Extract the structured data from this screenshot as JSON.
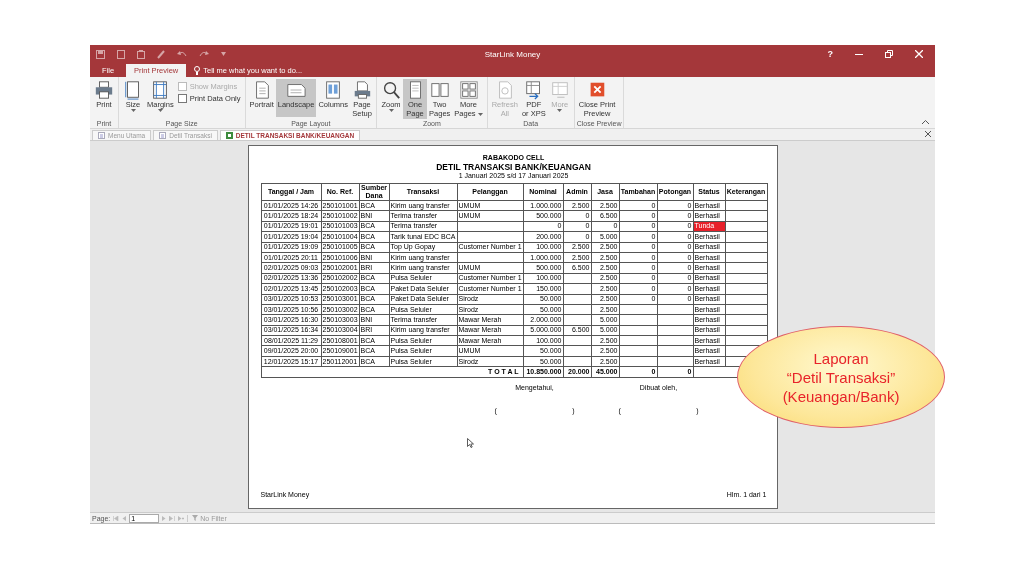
{
  "window": {
    "title": "StarLink Money",
    "help": "?"
  },
  "ribbon": {
    "tabs": [
      {
        "label": "File",
        "selected": false
      },
      {
        "label": "Print Preview",
        "selected": true
      }
    ],
    "tell_me": "Tell me what you want to do...",
    "groups": [
      {
        "label": "Print",
        "items": [
          {
            "kind": "large",
            "lines": [
              "Print"
            ],
            "selected": false,
            "disabled": false,
            "dropdown": false
          }
        ]
      },
      {
        "label": "Page Size",
        "items": [
          {
            "kind": "large",
            "lines": [
              "Size"
            ],
            "selected": false,
            "disabled": false,
            "dropdown": true
          },
          {
            "kind": "large",
            "lines": [
              "Margins"
            ],
            "selected": false,
            "disabled": false,
            "dropdown": true
          },
          {
            "kind": "checks",
            "checks": [
              {
                "label": "Show Margins",
                "checked": false,
                "disabled": true
              },
              {
                "label": "Print Data Only",
                "checked": false,
                "disabled": false
              }
            ]
          }
        ]
      },
      {
        "label": "Page Layout",
        "items": [
          {
            "kind": "large",
            "lines": [
              "Portrait"
            ],
            "selected": false,
            "disabled": false,
            "dropdown": false
          },
          {
            "kind": "large",
            "lines": [
              "Landscape"
            ],
            "selected": true,
            "disabled": false,
            "dropdown": false
          },
          {
            "kind": "large",
            "lines": [
              "Columns"
            ],
            "selected": false,
            "disabled": false,
            "dropdown": false
          },
          {
            "kind": "large",
            "lines": [
              "Page",
              "Setup"
            ],
            "selected": false,
            "disabled": false,
            "dropdown": false
          }
        ]
      },
      {
        "label": "Zoom",
        "items": [
          {
            "kind": "large",
            "lines": [
              "Zoom"
            ],
            "selected": false,
            "disabled": false,
            "dropdown": true
          },
          {
            "kind": "large",
            "lines": [
              "One",
              "Page"
            ],
            "selected": true,
            "disabled": false,
            "dropdown": false
          },
          {
            "kind": "large",
            "lines": [
              "Two",
              "Pages"
            ],
            "selected": false,
            "disabled": false,
            "dropdown": false
          },
          {
            "kind": "large",
            "lines": [
              "More",
              "Pages"
            ],
            "selected": false,
            "disabled": false,
            "dropdown": true
          }
        ]
      },
      {
        "label": "Data",
        "items": [
          {
            "kind": "large",
            "lines": [
              "Refresh",
              "All"
            ],
            "selected": false,
            "disabled": true,
            "dropdown": false
          },
          {
            "kind": "large",
            "lines": [
              "PDF",
              "or XPS"
            ],
            "selected": false,
            "disabled": false,
            "dropdown": false
          },
          {
            "kind": "large",
            "lines": [
              "More"
            ],
            "selected": false,
            "disabled": true,
            "dropdown": true
          }
        ]
      },
      {
        "label": "Close Preview",
        "items": [
          {
            "kind": "large",
            "lines": [
              "Close Print",
              "Preview"
            ],
            "selected": false,
            "disabled": false,
            "dropdown": false
          }
        ]
      }
    ]
  },
  "document_tabs": [
    {
      "label": "Menu Utama",
      "selected": false
    },
    {
      "label": "Detil Transaksi",
      "selected": false
    },
    {
      "label": "DETIL TRANSAKSI BANK/KEUANGAN",
      "selected": true
    }
  ],
  "report": {
    "company": "RABAKODO CELL",
    "title": "DETIL TRANSAKSI BANK/KEUANGAN",
    "period": "1 Januari 2025 s/d 17 Januari 2025",
    "columns": [
      "Tanggal / Jam",
      "No. Ref.",
      "Sumber Dana",
      "Transaksi",
      "Pelanggan",
      "Nominal",
      "Admin",
      "Jasa",
      "Tambahan",
      "Potongan",
      "Status",
      "Keterangan"
    ],
    "rows": [
      {
        "date": "01/01/2025 14:26",
        "ref": "250101001",
        "source": "BCA",
        "transaction": "Kirim uang transfer",
        "customer": "UMUM",
        "nominal": "1.000.000",
        "admin": "2.500",
        "jasa": "2.500",
        "tambahan": "0",
        "potongan": "0",
        "status": "Berhasil",
        "alert": false
      },
      {
        "date": "01/01/2025 18:24",
        "ref": "250101002",
        "source": "BNI",
        "transaction": "Terima transfer",
        "customer": "UMUM",
        "nominal": "500.000",
        "admin": "0",
        "jasa": "6.500",
        "tambahan": "0",
        "potongan": "0",
        "status": "Berhasil",
        "alert": false
      },
      {
        "date": "01/01/2025 19:01",
        "ref": "250101003",
        "source": "BCA",
        "transaction": "Terima transfer",
        "nominal": "0",
        "admin": "0",
        "jasa": "0",
        "tambahan": "0",
        "potongan": "0",
        "status": "Tunda",
        "alert": true
      },
      {
        "date": "01/01/2025 19:04",
        "ref": "250101004",
        "source": "BCA",
        "transaction": "Tarik tunai EDC BCA",
        "nominal": "200.000",
        "admin": "0",
        "jasa": "5.000",
        "tambahan": "0",
        "potongan": "0",
        "status": "Berhasil",
        "alert": false
      },
      {
        "date": "01/01/2025 19:09",
        "ref": "250101005",
        "source": "BCA",
        "transaction": "Top Up Gopay",
        "customer": "Customer Number 1",
        "nominal": "100.000",
        "admin": "2.500",
        "jasa": "2.500",
        "tambahan": "0",
        "potongan": "0",
        "status": "Berhasil",
        "alert": false
      },
      {
        "date": "01/01/2025 20:11",
        "ref": "250101006",
        "source": "BNI",
        "transaction": "Kirim uang transfer",
        "nominal": "1.000.000",
        "admin": "2.500",
        "jasa": "2.500",
        "tambahan": "0",
        "potongan": "0",
        "status": "Berhasil",
        "alert": false
      },
      {
        "date": "02/01/2025 09:03",
        "ref": "250102001",
        "source": "BRI",
        "transaction": "Kirim uang transfer",
        "customer": "UMUM",
        "nominal": "500.000",
        "admin": "6.500",
        "jasa": "2.500",
        "tambahan": "0",
        "potongan": "0",
        "status": "Berhasil",
        "alert": false
      },
      {
        "date": "02/01/2025 13:36",
        "ref": "250102002",
        "source": "BCA",
        "transaction": "Pulsa Seluler",
        "customer": "Customer Number 1",
        "nominal": "100.000",
        "jasa": "2.500",
        "tambahan": "0",
        "potongan": "0",
        "status": "Berhasil",
        "alert": false
      },
      {
        "date": "02/01/2025 13:45",
        "ref": "250102003",
        "source": "BCA",
        "transaction": "Paket Data Seluler",
        "customer": "Customer Number 1",
        "nominal": "150.000",
        "jasa": "2.500",
        "tambahan": "0",
        "potongan": "0",
        "status": "Berhasil",
        "alert": false
      },
      {
        "date": "03/01/2025 10:53",
        "ref": "250103001",
        "source": "BCA",
        "transaction": "Paket Data Seluler",
        "customer": "Sirodz",
        "nominal": "50.000",
        "jasa": "2.500",
        "tambahan": "0",
        "potongan": "0",
        "status": "Berhasil",
        "alert": false
      },
      {
        "date": "03/01/2025 10:56",
        "ref": "250103002",
        "source": "BCA",
        "transaction": "Pulsa Seluler",
        "customer": "Sirodz",
        "nominal": "50.000",
        "jasa": "2.500",
        "status": "Berhasil",
        "alert": false
      },
      {
        "date": "03/01/2025 16:30",
        "ref": "250103003",
        "source": "BNI",
        "transaction": "Terima transfer",
        "customer": "Mawar Merah",
        "nominal": "2.000.000",
        "jasa": "5.000",
        "status": "Berhasil",
        "alert": false
      },
      {
        "date": "03/01/2025 16:34",
        "ref": "250103004",
        "source": "BRI",
        "transaction": "Kirim uang transfer",
        "customer": "Mawar Merah",
        "nominal": "5.000.000",
        "admin": "6.500",
        "jasa": "5.000",
        "status": "Berhasil",
        "alert": false
      },
      {
        "date": "08/01/2025 11:29",
        "ref": "250108001",
        "source": "BCA",
        "transaction": "Pulsa Seluler",
        "customer": "Mawar Merah",
        "nominal": "100.000",
        "jasa": "2.500",
        "status": "Berhasil",
        "alert": false
      },
      {
        "date": "09/01/2025 20:00",
        "ref": "250109001",
        "source": "BCA",
        "transaction": "Pulsa Seluler",
        "customer": "UMUM",
        "nominal": "50.000",
        "jasa": "2.500",
        "status": "Berhasil",
        "alert": false
      },
      {
        "date": "12/01/2025 15:17",
        "ref": "250112001",
        "source": "BCA",
        "transaction": "Pulsa Seluler",
        "customer": "Sirodz",
        "nominal": "50.000",
        "jasa": "2.500",
        "status": "Berhasil",
        "alert": false
      }
    ],
    "total": {
      "label": "T O T A L",
      "nominal": "10.850.000",
      "admin": "20.000",
      "jasa": "45.000",
      "tambahan": "0",
      "potongan": "0"
    },
    "signatures": [
      {
        "label": "Mengetahui,",
        "open": "(",
        "close": ")"
      },
      {
        "label": "Dibuat oleh,",
        "open": "(",
        "close": ")"
      }
    ],
    "footer_left": "StarLink Money",
    "footer_right": "Hlm. 1 dari 1"
  },
  "status_bar": {
    "page_label": "Page:",
    "page_value": "1",
    "filter": "No Filter"
  },
  "callout": {
    "lines": [
      "Laporan",
      "“Detil Transaksi”",
      "(Keuangan/Bank)"
    ]
  }
}
